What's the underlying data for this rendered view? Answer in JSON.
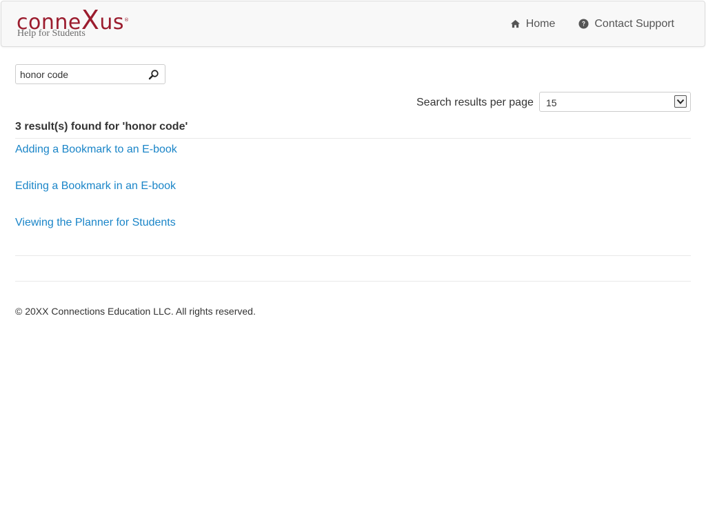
{
  "header": {
    "logo_text_pre": "conne",
    "logo_text_x": "X",
    "logo_text_post": "us",
    "logo_reg": "®",
    "logo_subtitle": "Help for Students",
    "nav": [
      {
        "label": "Home",
        "icon": "home-icon"
      },
      {
        "label": "Contact Support",
        "icon": "question-circle-icon"
      }
    ]
  },
  "search": {
    "value": "honor code",
    "placeholder": "",
    "button_icon": "search-icon"
  },
  "pagination": {
    "per_page_label": "Search results per page",
    "per_page_value": "15"
  },
  "results": {
    "summary": "3 result(s) found for 'honor code'",
    "items": [
      {
        "title": "Adding a Bookmark to an E-book"
      },
      {
        "title": "Editing a Bookmark in an E-book"
      },
      {
        "title": "Viewing the Planner for Students"
      }
    ]
  },
  "footer": {
    "copyright": "© 20XX Connections Education LLC. All rights reserved."
  },
  "colors": {
    "brand": "#9b1c2e",
    "link": "#1a85c8",
    "text": "#333333",
    "nav_bg": "#f8f8f8"
  }
}
